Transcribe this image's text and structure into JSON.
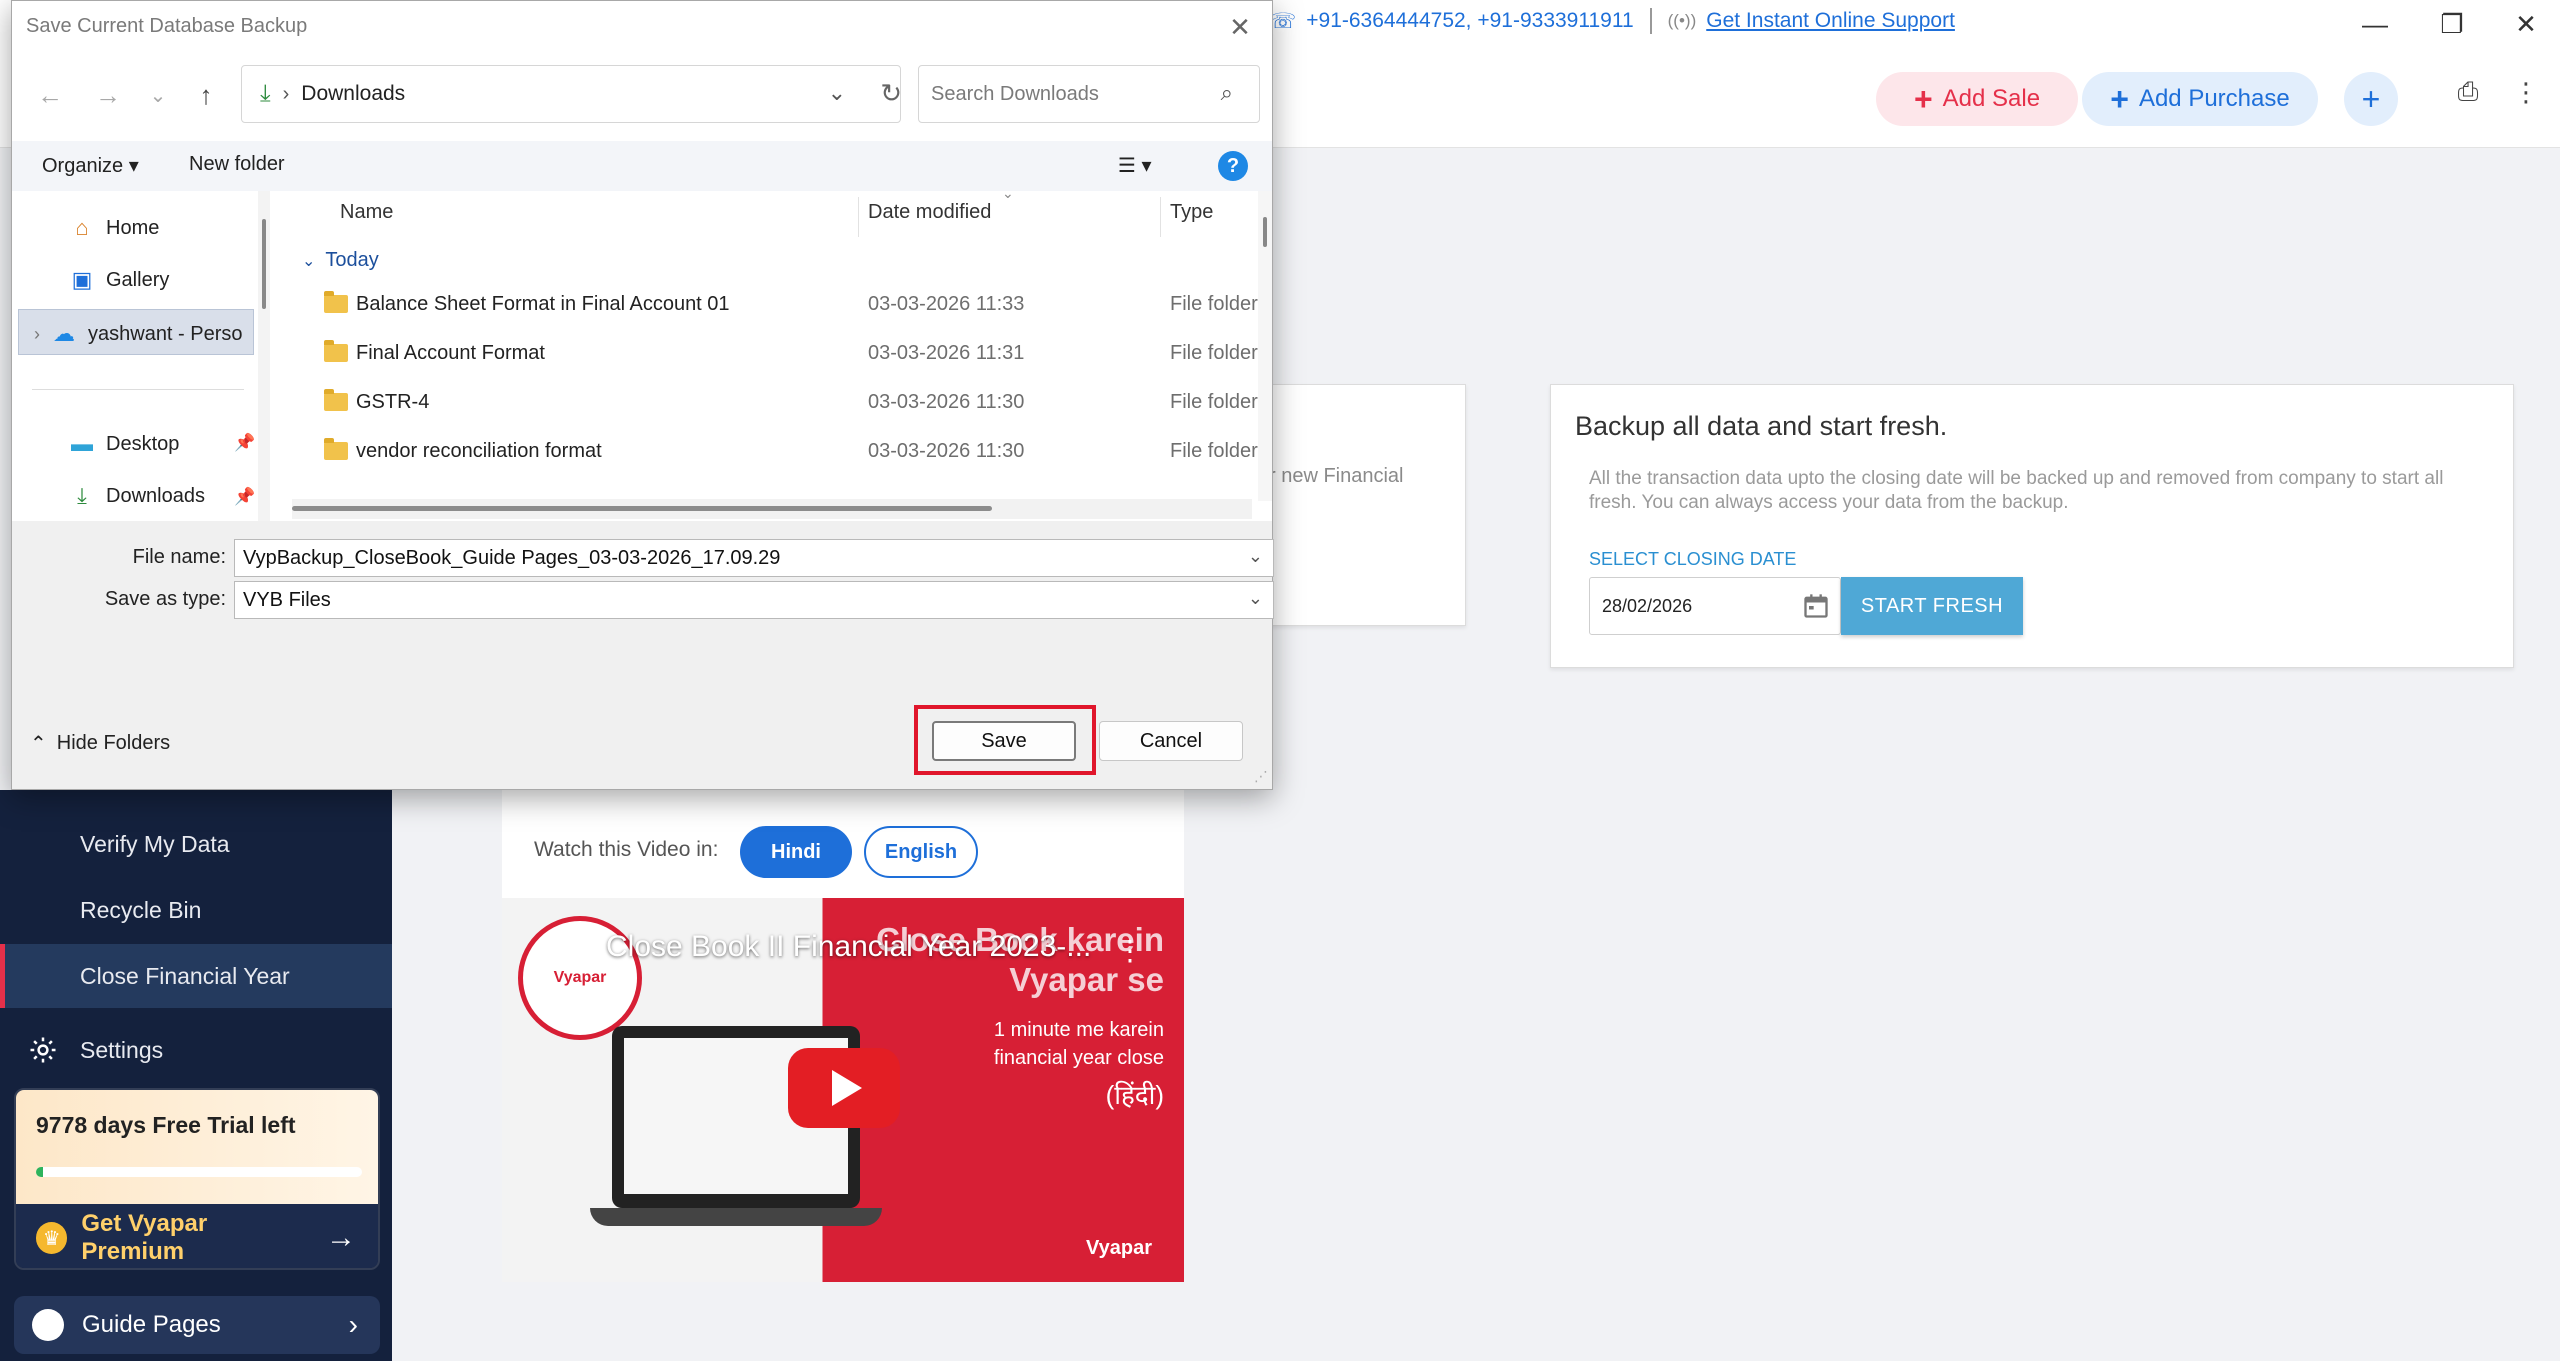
{
  "app": {
    "contact_numbers": "+91-6364444752, +91-9333911911",
    "support_link": "Get Instant Online Support",
    "actions": {
      "add_sale": "Add Sale",
      "add_purchase": "Add Purchase"
    },
    "left_card_fragment": "r new Financial",
    "backup_card": {
      "title": "Backup all data and start fresh.",
      "description": "All the transaction data upto the closing date will be backed up and removed from company to start all fresh. You can always access your data from the backup.",
      "date_label": "SELECT CLOSING DATE",
      "date_value": "28/02/2026",
      "button": "START FRESH"
    },
    "sidebar": {
      "items": [
        {
          "label": "Verify My Data"
        },
        {
          "label": "Recycle Bin"
        },
        {
          "label": "Close Financial Year",
          "active": true
        },
        {
          "label": "Settings"
        }
      ],
      "trial_text": "9778 days Free Trial left",
      "trial_progress_percent": 2,
      "premium_label": "Get Vyapar Premium",
      "guide_label": "Guide Pages"
    },
    "video": {
      "watch_label": "Watch this Video in:",
      "hindi": "Hindi",
      "english": "English",
      "title": "Close Book II Financial Year 2023-...",
      "big_text_1": "Close Book karein",
      "big_text_2": "Vyapar se",
      "sub_text_1": "1 minute me karein",
      "sub_text_2": "financial year close",
      "hindi_text": "(हिंदी)",
      "logo_text": "Vyapar",
      "brand": "Vyapar"
    }
  },
  "dialog": {
    "title": "Save Current Database Backup",
    "address_path": "Downloads",
    "search_placeholder": "Search Downloads",
    "commands": {
      "organize": "Organize",
      "new_folder": "New folder"
    },
    "nav": {
      "home": "Home",
      "gallery": "Gallery",
      "onedrive": "yashwant - Perso",
      "desktop": "Desktop",
      "downloads": "Downloads"
    },
    "columns": {
      "name": "Name",
      "date": "Date modified",
      "type": "Type"
    },
    "group": "Today",
    "files": [
      {
        "name": "Balance Sheet Format in Final Account 01",
        "date": "03-03-2026 11:33",
        "type": "File folder"
      },
      {
        "name": "Final Account Format",
        "date": "03-03-2026 11:31",
        "type": "File folder"
      },
      {
        "name": "GSTR-4",
        "date": "03-03-2026 11:30",
        "type": "File folder"
      },
      {
        "name": "vendor reconciliation format",
        "date": "03-03-2026 11:30",
        "type": "File folder"
      }
    ],
    "file_name_label": "File name:",
    "file_name_value": "VypBackup_CloseBook_Guide Pages_03-03-2026_17.09.29",
    "save_type_label": "Save as type:",
    "save_type_value": "VYB Files",
    "hide_folders": "Hide Folders",
    "save_button": "Save",
    "cancel_button": "Cancel"
  },
  "colors": {
    "accent_blue": "#1e6fd9",
    "accent_red": "#e5304a",
    "sidebar_bg": "#14213d",
    "highlight_red": "#e0162b"
  }
}
